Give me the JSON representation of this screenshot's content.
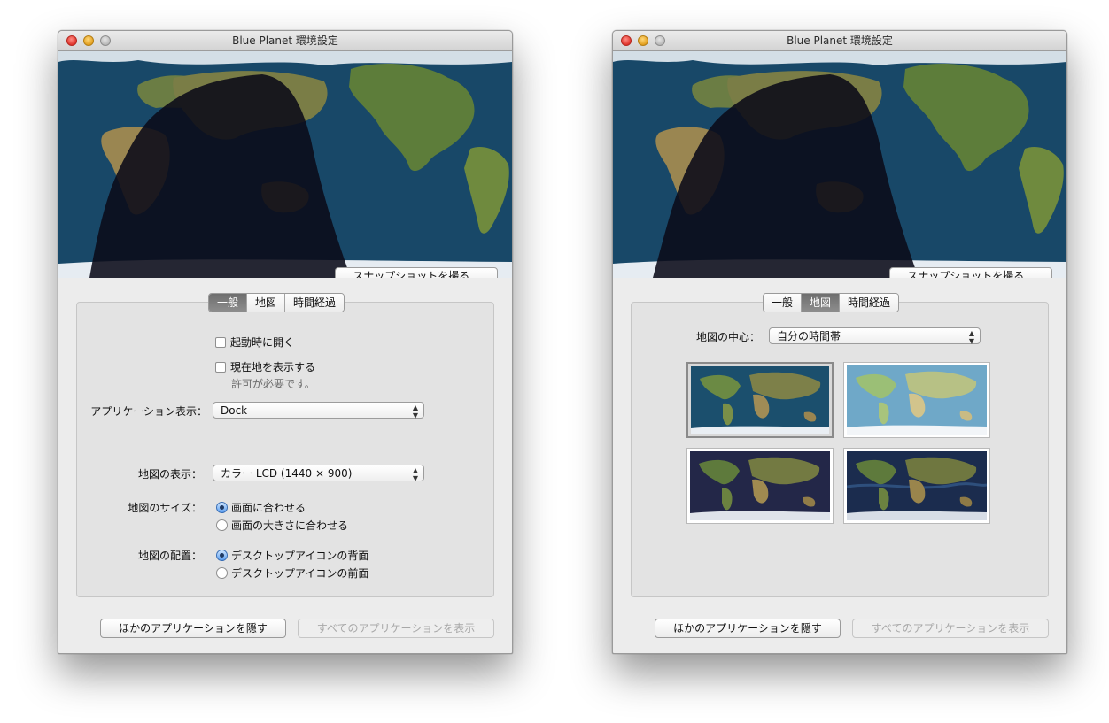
{
  "window_title": "Blue Planet 環境設定",
  "snapshot_button": "スナップショットを撮る...",
  "tabs": [
    "一般",
    "地図",
    "時間経過"
  ],
  "left": {
    "active_tab": "一般",
    "open_at_login": "起動時に開く",
    "show_location": "現在地を表示する",
    "permission_note": "許可が必要です。",
    "app_display_label": "アプリケーション表示：",
    "app_display_value": "Dock",
    "map_display_label": "地図の表示：",
    "map_display_value": "カラー LCD (1440 × 900)",
    "map_size_label": "地図のサイズ：",
    "map_size_options": [
      "画面に合わせる",
      "画面の大きさに合わせる"
    ],
    "map_size_selected": 0,
    "map_place_label": "地図の配置：",
    "map_place_options": [
      "デスクトップアイコンの背面",
      "デスクトップアイコンの前面"
    ],
    "map_place_selected": 0
  },
  "right": {
    "active_tab": "地図",
    "map_center_label": "地図の中心：",
    "map_center_value": "自分の時間帯",
    "map_styles": [
      "satellite-daylight",
      "relief-light",
      "satellite-night-sky",
      "satellite-bathymetry"
    ],
    "selected_style": 0
  },
  "bottom": {
    "hide_others": "ほかのアプリケーションを隠す",
    "show_all": "すべてのアプリケーションを表示",
    "show_all_enabled": false
  },
  "colors": {
    "selected_tab": "#7a7a7a",
    "radio_selected": "#4a8de6",
    "map_ocean": "#184868"
  }
}
